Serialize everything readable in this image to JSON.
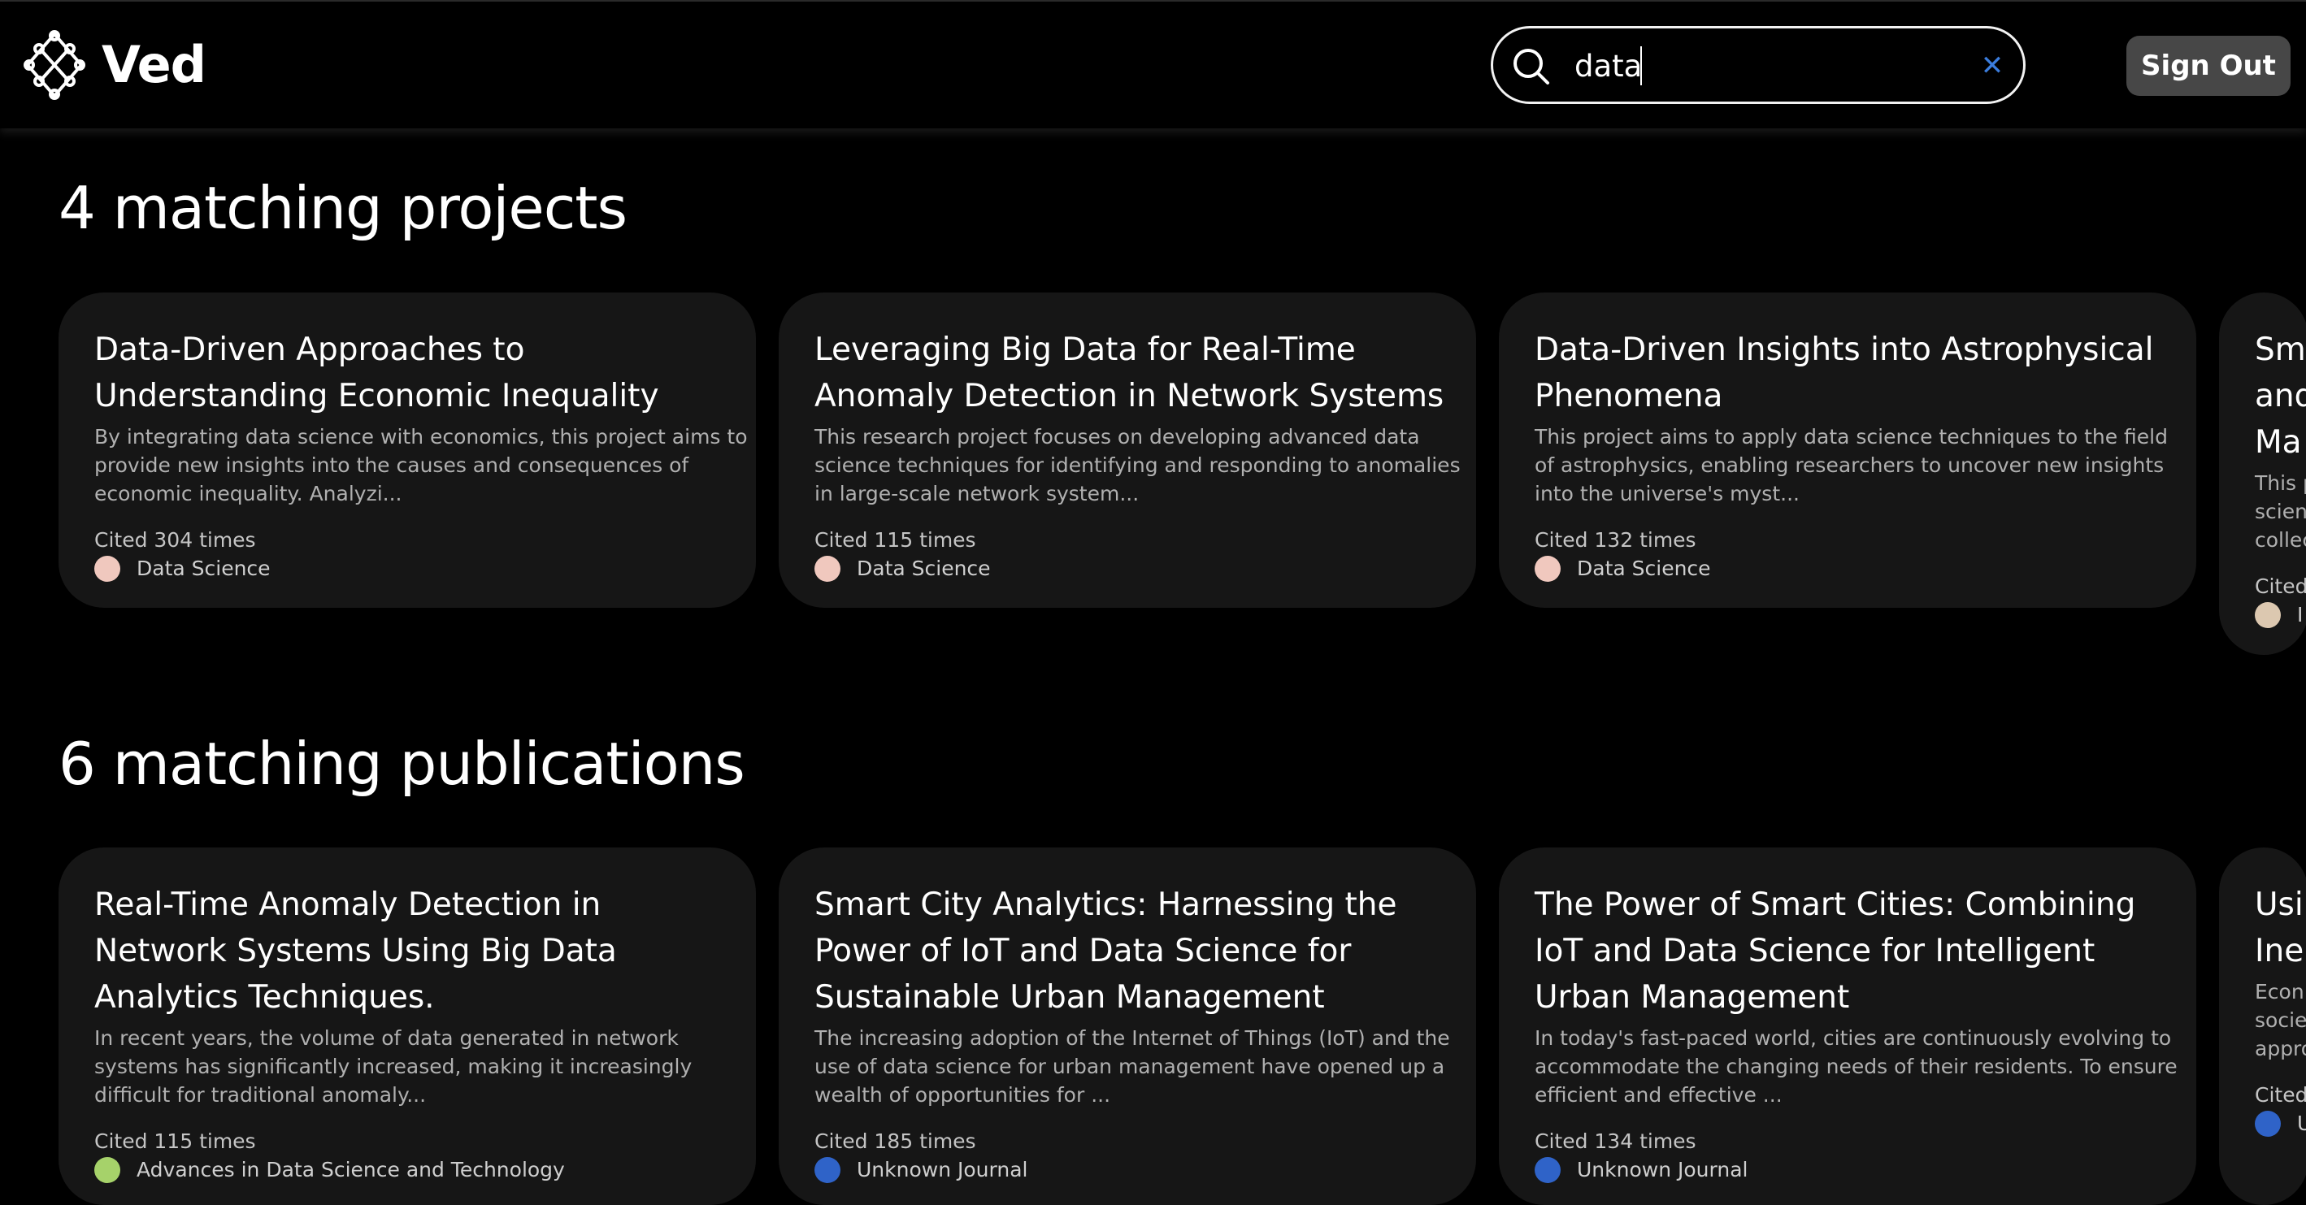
{
  "header": {
    "logo_text": "Ved",
    "search": {
      "value": "data",
      "placeholder": ""
    },
    "signout_label": "Sign Out"
  },
  "projects": {
    "heading": "4 matching projects",
    "items": [
      {
        "title_lines": [
          "Data-Driven Approaches to",
          "Understanding Economic Inequality"
        ],
        "desc_lines": [
          "By integrating data science with economics, this project aims to",
          "provide new insights into the causes and consequences of",
          "economic inequality. Analyzi..."
        ],
        "cited": "Cited 304 times",
        "tag": "Data Science",
        "tag_color": "#f0c8be"
      },
      {
        "title_lines": [
          "Leveraging Big Data for Real-Time",
          "Anomaly Detection in Network Systems"
        ],
        "desc_lines": [
          "This research project focuses on developing advanced data",
          "science techniques for identifying and responding to anomalies",
          "in large-scale network system..."
        ],
        "cited": "Cited 115 times",
        "tag": "Data Science",
        "tag_color": "#f0c8be"
      },
      {
        "title_lines": [
          "Data-Driven Insights into Astrophysical",
          "Phenomena"
        ],
        "desc_lines": [
          "This project aims to apply data science techniques to the field",
          "of astrophysics, enabling researchers to uncover new insights",
          "into the universe's myst..."
        ],
        "cited": "Cited 132 times",
        "tag": "Data Science",
        "tag_color": "#f0c8be"
      },
      {
        "title_lines": [
          "Sm",
          "and",
          "Ma"
        ],
        "desc_lines": [
          "This p",
          "scien",
          "collec"
        ],
        "cited": "Cited",
        "tag": "I",
        "tag_color": "#dcc8b0"
      }
    ]
  },
  "publications": {
    "heading": "6 matching publications",
    "items": [
      {
        "title_lines": [
          "Real-Time Anomaly Detection in",
          "Network Systems Using Big Data",
          "Analytics Techniques."
        ],
        "desc_lines": [
          "In recent years, the volume of data generated in network",
          "systems has significantly increased, making it increasingly",
          "difficult for traditional anomaly..."
        ],
        "cited": "Cited 115 times",
        "tag": "Advances in Data Science and Technology",
        "tag_color": "#a6d26a"
      },
      {
        "title_lines": [
          "Smart City Analytics: Harnessing the",
          "Power of IoT and Data Science for",
          "Sustainable Urban Management"
        ],
        "desc_lines": [
          "The increasing adoption of the Internet of Things (IoT) and the",
          "use of data science for urban management have opened up a",
          "wealth of opportunities for ..."
        ],
        "cited": "Cited 185 times",
        "tag": "Unknown Journal",
        "tag_color": "#2f63c8"
      },
      {
        "title_lines": [
          "The Power of Smart Cities: Combining",
          "IoT and Data Science for Intelligent",
          "Urban Management"
        ],
        "desc_lines": [
          "In today's fast-paced world, cities are continuously evolving to",
          "accommodate the changing needs of their residents. To ensure",
          "efficient and effective ..."
        ],
        "cited": "Cited 134 times",
        "tag": "Unknown Journal",
        "tag_color": "#2f63c8"
      },
      {
        "title_lines": [
          "Usi",
          "Ine"
        ],
        "desc_lines": [
          "Econ",
          "socie",
          "appro"
        ],
        "cited": "Cited",
        "tag": "U",
        "tag_color": "#2f63c8"
      }
    ]
  }
}
